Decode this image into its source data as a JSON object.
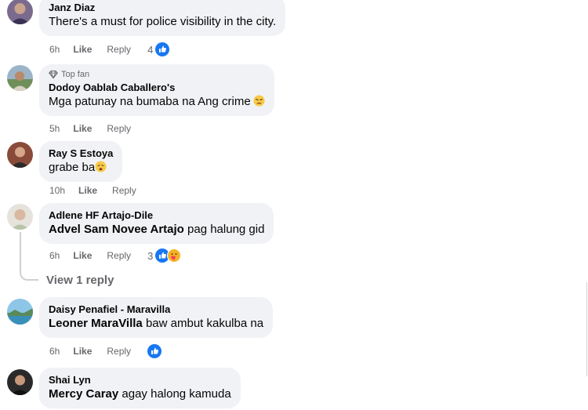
{
  "comments": [
    {
      "author": "Janz Diaz",
      "text": "There's a must for police visibility in the city.",
      "time": "6h",
      "like": "Like",
      "reply": "Reply",
      "reaction_count": "4"
    },
    {
      "badge": "Top fan",
      "author": "Dodoy Oablab Caballero's",
      "text": "Mga patunay na bumaba na Ang crime",
      "emoji": "tired-face-emoji",
      "time": "5h",
      "like": "Like",
      "reply": "Reply"
    },
    {
      "author": "Ray S Estoya",
      "text": "grabe ba",
      "emoji": "weary-face-emoji",
      "time": "10h",
      "like": "Like",
      "reply": "Reply"
    },
    {
      "author": "Adlene HF Artajo-Dile",
      "mention": "Advel Sam Novee Artajo",
      "text": " pag halung gid",
      "time": "6h",
      "like": "Like",
      "reply": "Reply",
      "reaction_count": "3"
    },
    {
      "author": "Daisy Penafiel - Maravilla",
      "mention": "Leoner MaraVilla",
      "text": " baw ambut kakulba na",
      "time": "6h",
      "like": "Like",
      "reply": "Reply"
    },
    {
      "author": "Shai Lyn",
      "mention": "Mercy Caray",
      "text": " agay halong kamuda"
    }
  ],
  "view_replies": "View 1 reply",
  "colors": {
    "bubble": "#f0f2f5",
    "meta_text": "#65676b",
    "like_blue": "#1877f2",
    "care_yellow": "#f7b125",
    "thread_line": "#ced0d4"
  }
}
